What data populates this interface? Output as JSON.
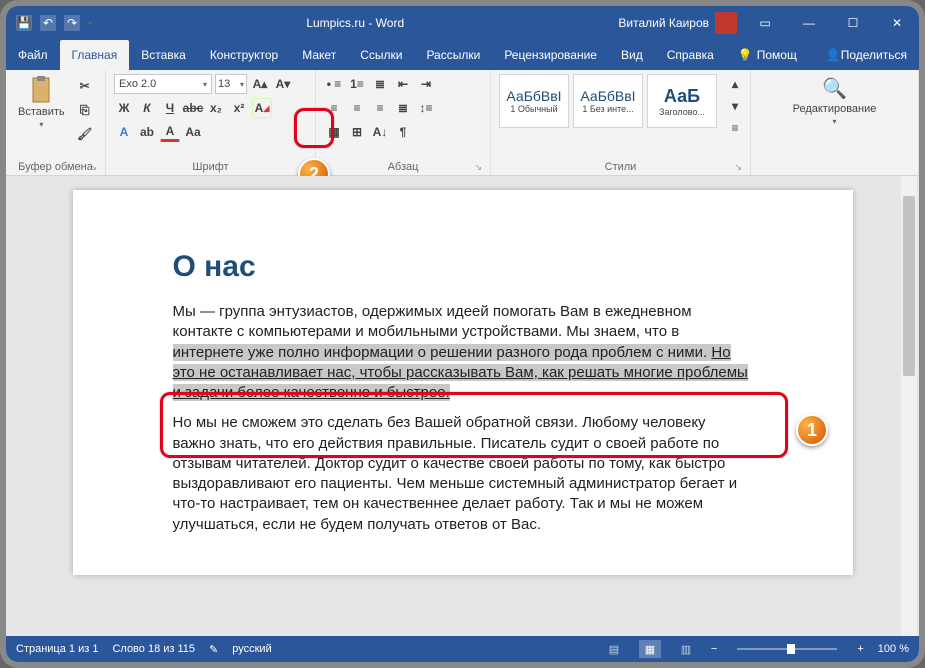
{
  "title": "Lumpics.ru - Word",
  "user_name": "Виталий Каиров",
  "tabs": {
    "file": "Файл",
    "home": "Главная",
    "insert": "Вставка",
    "design": "Конструктор",
    "layout": "Макет",
    "references": "Ссылки",
    "mailings": "Рассылки",
    "review": "Рецензирование",
    "view": "Вид",
    "help": "Справка",
    "tell_me": "Помощ",
    "share": "Поделиться"
  },
  "ribbon": {
    "clipboard": {
      "label": "Буфер обмена",
      "paste": "Вставить"
    },
    "font": {
      "label": "Шрифт",
      "name": "Exo 2.0",
      "size": "13"
    },
    "paragraph": {
      "label": "Абзац"
    },
    "styles": {
      "label": "Стили",
      "items": [
        {
          "preview": "АаБбВвІ",
          "name": "1 Обычный"
        },
        {
          "preview": "АаБбВвІ",
          "name": "1 Без инте..."
        },
        {
          "preview": "АаБ",
          "name": "Заголово..."
        }
      ]
    },
    "editing": {
      "label": "Редактирование"
    }
  },
  "document": {
    "heading": "О нас",
    "p1_a": "Мы — группа энтузиастов, одержимых идеей помогать Вам в ежедневном контакте с компьютерами и мобильными устройствами. Мы знаем, что в ",
    "p1_sel_plain": "интернете уже полно информации о решении разного рода проблем с ними. ",
    "p1_sel_u": "Но это не останавливает нас, чтобы рассказывать Вам, как решать многие проблемы и задачи более качественно и быстрее.",
    "p2": "Но мы не сможем это сделать без Вашей обратной связи. Любому человеку важно знать, что его действия правильные. Писатель судит о своей работе по отзывам читателей. Доктор судит о качестве своей работы по тому, как быстро выздоравливают его пациенты. Чем меньше системный администратор бегает и что-то настраивает, тем он качественнее делает работу. Так и мы не можем улучшаться, если не будем получать ответов от Вас."
  },
  "status": {
    "page": "Страница 1 из 1",
    "words": "Слово 18 из 115",
    "lang": "русский",
    "zoom": "100 %"
  },
  "callouts": {
    "one": "1",
    "two": "2"
  }
}
